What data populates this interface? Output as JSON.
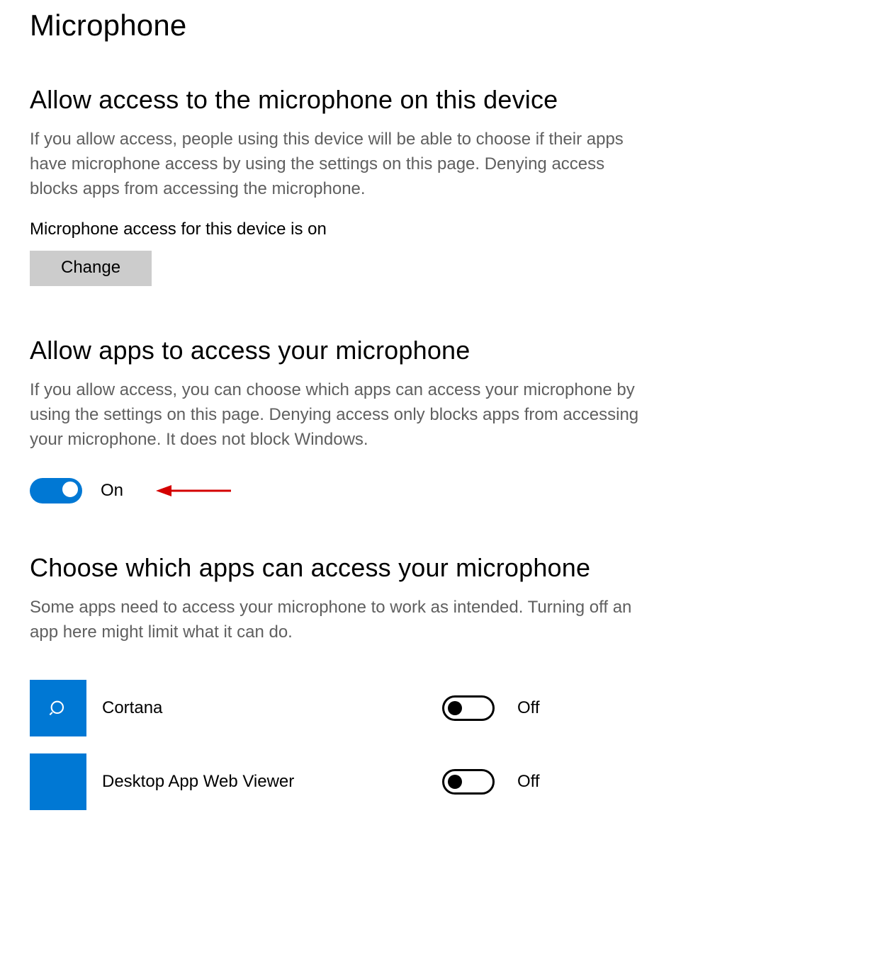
{
  "page": {
    "title": "Microphone"
  },
  "section_device": {
    "heading": "Allow access to the microphone on this device",
    "desc": "If you allow access, people using this device will be able to choose if their apps have microphone access by using the settings on this page. Denying access blocks apps from accessing the microphone.",
    "status": "Microphone access for this device is on",
    "change_button": "Change"
  },
  "section_apps": {
    "heading": "Allow apps to access your microphone",
    "desc": "If you allow access, you can choose which apps can access your microphone by using the settings on this page. Denying access only blocks apps from accessing your microphone. It does not block Windows.",
    "toggle_state": "On"
  },
  "section_choose": {
    "heading": "Choose which apps can access your microphone",
    "desc": "Some apps need to access your microphone to work as intended. Turning off an app here might limit what it can do.",
    "apps": [
      {
        "name": "Cortana",
        "state": "Off",
        "icon": "search"
      },
      {
        "name": "Desktop App Web Viewer",
        "state": "Off",
        "icon": "blank"
      }
    ]
  },
  "colors": {
    "accent": "#0078d4",
    "annotation": "#d40000"
  }
}
